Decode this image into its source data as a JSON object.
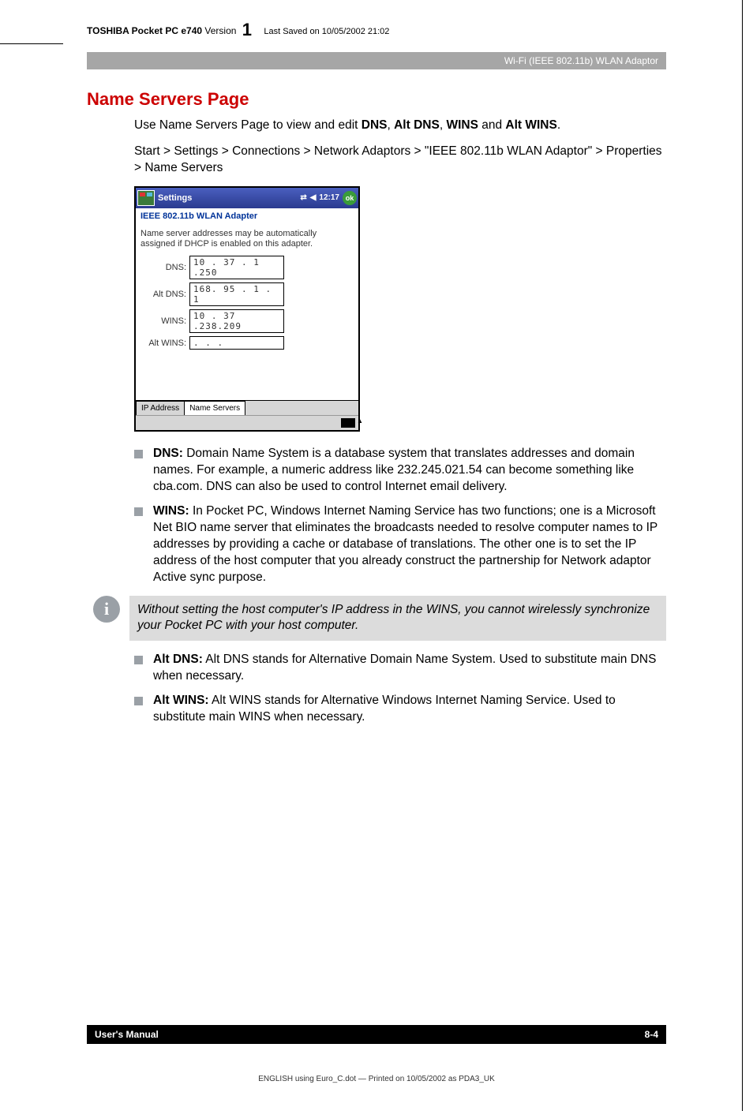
{
  "header": {
    "product": "TOSHIBA Pocket PC e740",
    "version_label": "Version",
    "version_num": "1",
    "saved": "Last Saved on 10/05/2002 21:02"
  },
  "section_band": "Wi-Fi (IEEE 802.11b) WLAN Adaptor",
  "title": "Name Servers Page",
  "intro1_pre": "Use Name Servers Page to view and edit ",
  "intro_bold": {
    "dns": "DNS",
    "altdns": "Alt DNS",
    "wins": "WINS",
    "altwins": "Alt WINS"
  },
  "intro1_join1": ", ",
  "intro1_join2": ", ",
  "intro1_join3": " and ",
  "intro1_end": ".",
  "path": "Start > Settings > Connections > Network Adaptors > \"IEEE 802.11b WLAN Adaptor\" > Properties > Name Servers",
  "ss": {
    "titlebar": "Settings",
    "time": "12:17",
    "ok": "ok",
    "subtitle": "IEEE 802.11b WLAN Adapter",
    "desc": "Name server addresses may be automatically assigned if DHCP is enabled on this adapter.",
    "rows": [
      {
        "label": "DNS:",
        "value": " 10 . 37 .  1 .250"
      },
      {
        "label": "Alt DNS:",
        "value": "168. 95 .  1 .  1"
      },
      {
        "label": "WINS:",
        "value": " 10 . 37 .238.209"
      },
      {
        "label": "Alt WINS:",
        "value": "   .    .    .   "
      }
    ],
    "tabs": {
      "ip": "IP Address",
      "ns": "Name Servers"
    }
  },
  "bullets1": [
    {
      "term": "DNS:",
      "text": " Domain Name System is a database system that translates addresses and domain names. For example, a numeric address like 232.245.021.54 can become something like cba.com. DNS can also be used to control Internet email delivery."
    },
    {
      "term": "WINS:",
      "text": " In Pocket PC, Windows Internet Naming Service has two functions; one is a Microsoft Net BIO name server that eliminates the broadcasts needed to resolve computer names to IP addresses by providing a cache or database of translations. The other one is to set the IP address of the host computer that you already construct the partnership for Network adaptor Active sync purpose."
    }
  ],
  "note": "Without setting the host computer's IP address in the WINS, you cannot wirelessly synchronize your Pocket PC with your host computer.",
  "bullets2": [
    {
      "term": "Alt DNS:",
      "text": " Alt DNS stands for Alternative Domain Name System. Used to substitute main DNS when necessary."
    },
    {
      "term": "Alt WINS:",
      "text": " Alt WINS stands for Alternative Windows Internet Naming Service. Used to substitute main WINS when necessary."
    }
  ],
  "footer": {
    "left": "User's Manual",
    "right": "8-4"
  },
  "print": "ENGLISH using  Euro_C.dot — Printed on 10/05/2002 as PDA3_UK"
}
